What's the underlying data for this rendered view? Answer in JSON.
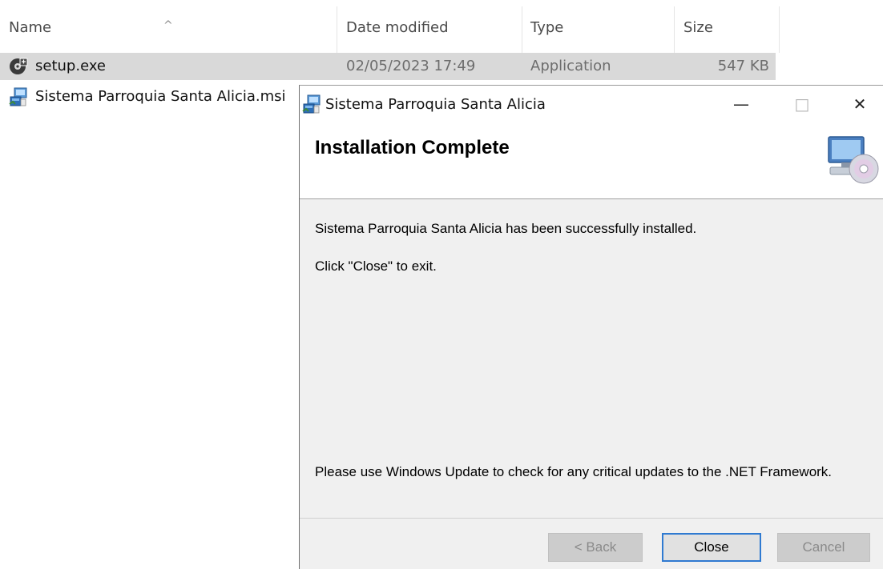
{
  "explorer": {
    "columns": {
      "name": "Name",
      "date_modified": "Date modified",
      "type": "Type",
      "size": "Size"
    },
    "sort_indicator": "^",
    "files": [
      {
        "name": "setup.exe",
        "date": "02/05/2023 17:49",
        "type": "Application",
        "size": "547 KB",
        "icon": "setup-exe-icon",
        "selected": true
      },
      {
        "name": "Sistema Parroquia Santa Alicia.msi",
        "date": "",
        "type": "",
        "size": "",
        "icon": "msi-installer-icon",
        "selected": false
      }
    ]
  },
  "dialog": {
    "title": "Sistema Parroquia Santa Alicia",
    "controls": {
      "minimize": "—",
      "maximize": "□",
      "close": "✕"
    },
    "banner_title": "Installation Complete",
    "banner_icon": "computer-cd-icon",
    "message_success": "Sistema Parroquia Santa Alicia has been successfully installed.",
    "message_exit": "Click \"Close\" to exit.",
    "message_update": "Please use Windows Update to check for any critical updates to the .NET Framework.",
    "buttons": {
      "back": "< Back",
      "close": "Close",
      "cancel": "Cancel"
    }
  },
  "colors": {
    "selection": "#d9d9d9",
    "dialog_bg": "#f0f0f0",
    "default_button_border": "#2f7ad1"
  }
}
